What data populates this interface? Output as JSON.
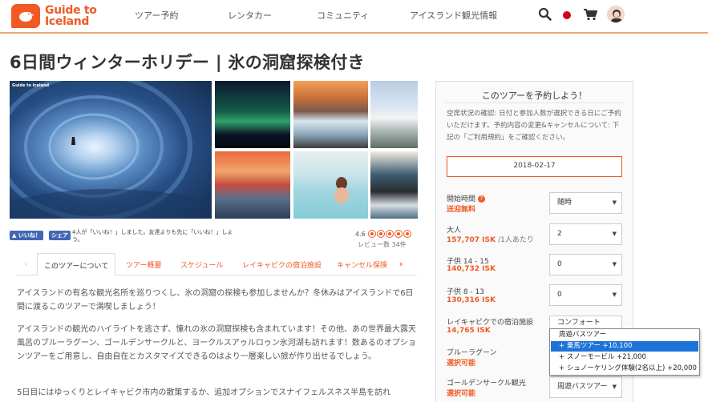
{
  "header": {
    "logo_line1": "Guide to",
    "logo_line2": "Iceland",
    "nav": [
      "ツアー予約",
      "レンタカー",
      "コミュニティ",
      "アイスランド観光情報"
    ],
    "icons": [
      "search-icon",
      "language-flag-icon",
      "cart-icon",
      "avatar"
    ],
    "accent": "#f15a24"
  },
  "title": "6日間ウィンターホリデー | 氷の洞窟探検付き",
  "gallery": {
    "watermark": "Guide to Iceland"
  },
  "social": {
    "like_label": "いいね！",
    "share_label": "シェア",
    "text": "4人が「いいね！」しました。友達よりも先に「いいね！」しよう。"
  },
  "rating": {
    "score": "4.6",
    "stars": 5,
    "reviews": "レビュー数 34件"
  },
  "tabs": [
    "このツアーについて",
    "ツアー概要",
    "スケジュール",
    "レイキャビクの宿泊施設",
    "キャンセル保険"
  ],
  "description": [
    "アイスランドの有名な観光名所を巡りつくし、氷の洞窟の探検も参加しませんか？冬休みはアイスランドで6日間に渡るこのツアーで満喫しましょう！",
    "アイスランドの観光のハイライトを逃さず、憧れの氷の洞窟探検も含まれています！その他、あの世界最大露天風呂のブルーラグーン、ゴールデンサークルと、ヨークルスアゥルロゥン氷河湖も訪れます！数あるのオプションツアーをご用意し、自由自在とカスタマイズできるのはより一層楽しい旅が作り出せるでしょう。",
    "5日目にはゆっくりとレイキャビク市内の散策するか、追加オプションでスナイフェルスネス半島を訪れ"
  ],
  "booking": {
    "title": "このツアーを予約しよう！",
    "info": "空席状況の確認: 日付と参加人数が選択できる日にご予約いただけます。予約内容の変更&キャンセルについて: 下記の「ご利用規約」をご確認ください。",
    "date": "2018-02-17",
    "rows": [
      {
        "label": "開始時間",
        "sub": "送迎無料",
        "value": "随時"
      },
      {
        "label": "大人",
        "sub": "157,707 ISK",
        "per": "/1人あたり",
        "value": "2"
      },
      {
        "label": "子供 14 - 15",
        "sub": "140,732 ISK",
        "value": "0"
      },
      {
        "label": "子供 8 - 13",
        "sub": "130,316 ISK",
        "value": "0"
      },
      {
        "label": "レイキャビクでの宿泊施設",
        "sub": "14,765 ISK",
        "value": "コンフォート"
      },
      {
        "label": "ブルーラグーン",
        "sub": "選択可能"
      },
      {
        "label": "ゴールデンサークル観光",
        "sub": "選択可能",
        "value": "周遊バスツアー"
      }
    ],
    "dropdown": [
      "周遊バスツアー",
      "+ 乗馬ツアー +10,100",
      "+ スノーモービル +21,000",
      "+ シュノーケリング体験(2名以上) +20,000"
    ],
    "dropdown_highlight": 1
  }
}
